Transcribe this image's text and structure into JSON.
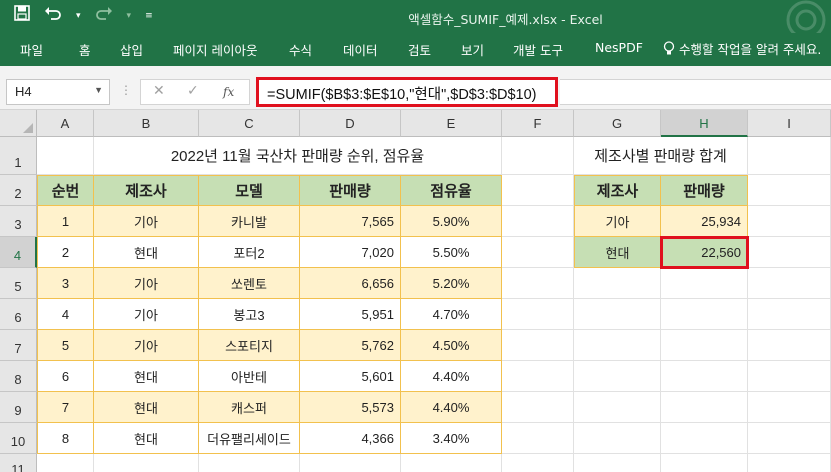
{
  "app": {
    "window_title": "액셀함수_SUMIF_예제.xlsx - Excel",
    "qat": {
      "save_icon": "save-icon",
      "undo_icon": "undo-icon",
      "redo_icon": "redo-icon",
      "customize_icon": "customize-qat-icon"
    }
  },
  "ribbon": {
    "tabs": [
      "파일",
      "홈",
      "삽입",
      "페이지 레이아웃",
      "수식",
      "데이터",
      "검토",
      "보기",
      "개발 도구",
      "NesPDF"
    ],
    "tell_me": "수행할 작업을 알려 주세요."
  },
  "formula_bar": {
    "name_box": "H4",
    "cancel_icon": "✕",
    "enter_icon": "✓",
    "fx_label": "fx",
    "formula": "=SUMIF($B$3:$E$10,\"현대\",$D$3:$D$10)"
  },
  "sheet": {
    "columns": [
      "A",
      "B",
      "C",
      "D",
      "E",
      "F",
      "G",
      "H",
      "I"
    ],
    "rows": [
      "1",
      "2",
      "3",
      "4",
      "5",
      "6",
      "7",
      "8",
      "9",
      "10",
      "11"
    ],
    "selected_cell": "H4",
    "main_table": {
      "title": "2022년 11월 국산차 판매량 순위, 점유율",
      "headers": [
        "순번",
        "제조사",
        "모델",
        "판매량",
        "점유율"
      ],
      "rows": [
        [
          "1",
          "기아",
          "카니발",
          "7,565",
          "5.90%"
        ],
        [
          "2",
          "현대",
          "포터2",
          "7,020",
          "5.50%"
        ],
        [
          "3",
          "기아",
          "쏘렌토",
          "6,656",
          "5.20%"
        ],
        [
          "4",
          "기아",
          "봉고3",
          "5,951",
          "4.70%"
        ],
        [
          "5",
          "기아",
          "스포티지",
          "5,762",
          "4.50%"
        ],
        [
          "6",
          "현대",
          "아반테",
          "5,601",
          "4.40%"
        ],
        [
          "7",
          "현대",
          "캐스퍼",
          "5,573",
          "4.40%"
        ],
        [
          "8",
          "현대",
          "더유팰리세이드",
          "4,366",
          "3.40%"
        ]
      ]
    },
    "summary_table": {
      "title": "제조사별 판매량 합계",
      "headers": [
        "제조사",
        "판매량"
      ],
      "rows": [
        [
          "기아",
          "25,934"
        ],
        [
          "현대",
          "22,560"
        ]
      ]
    },
    "colors": {
      "excel_green": "#217346",
      "header_fill": "#c6dfb4",
      "row_fill": "#fff2cc",
      "table_border": "#f2c14e",
      "highlight": "#e0101e"
    }
  }
}
